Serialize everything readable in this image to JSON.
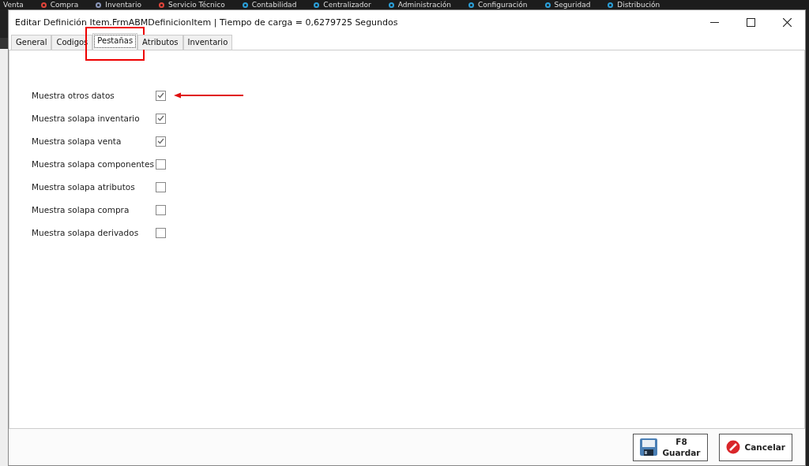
{
  "background_menu": [
    {
      "label": "Venta"
    },
    {
      "label": "Compra",
      "color": "#e0443a"
    },
    {
      "label": "Inventario",
      "color": "#8a96b8"
    },
    {
      "label": "Servicio Técnico",
      "color": "#e0443a"
    },
    {
      "label": "Contabilidad",
      "color": "#2b9fd8"
    },
    {
      "label": "Centralizador",
      "color": "#2b9fd8"
    },
    {
      "label": "Administración",
      "color": "#2b9fd8"
    },
    {
      "label": "Configuración",
      "color": "#2b9fd8"
    },
    {
      "label": "Seguridad",
      "color": "#2b9fd8"
    },
    {
      "label": "Distribución",
      "color": "#2b9fd8"
    }
  ],
  "window": {
    "title": "Editar Definición Item.FrmABMDefinicionItem | Tiempo de carga = 0,6279725 Segundos"
  },
  "tabs": [
    {
      "label": "General",
      "selected": false,
      "highlighted": false
    },
    {
      "label": "Codigos",
      "selected": false,
      "highlighted": false
    },
    {
      "label": "Pestañas",
      "selected": true,
      "highlighted": true
    },
    {
      "label": "Atributos",
      "selected": false,
      "highlighted": false
    },
    {
      "label": "Inventario",
      "selected": false,
      "highlighted": false
    }
  ],
  "options": [
    {
      "label": "Muestra otros datos",
      "checked": true,
      "arrow": true
    },
    {
      "label": "Muestra solapa inventario",
      "checked": true,
      "arrow": false
    },
    {
      "label": "Muestra solapa venta",
      "checked": true,
      "arrow": false
    },
    {
      "label": "Muestra solapa componentes",
      "checked": false,
      "arrow": false
    },
    {
      "label": "Muestra solapa atributos",
      "checked": false,
      "arrow": false
    },
    {
      "label": "Muestra solapa compra",
      "checked": false,
      "arrow": false
    },
    {
      "label": "Muestra solapa derivados",
      "checked": false,
      "arrow": false
    }
  ],
  "buttons": [
    {
      "kind": "save",
      "label": "F8\nGuardar"
    },
    {
      "kind": "cancel",
      "label": "Cancelar"
    }
  ]
}
